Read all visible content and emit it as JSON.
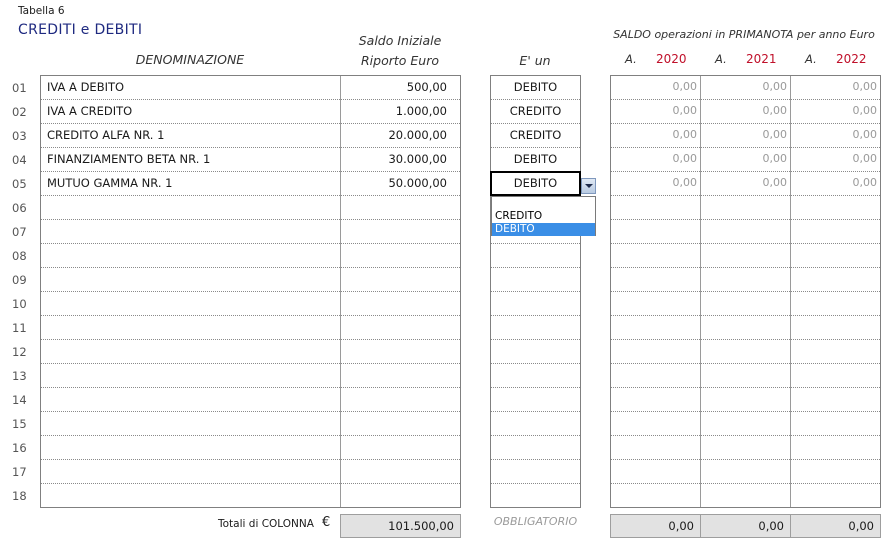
{
  "sheet": {
    "caption": "Tabella 6",
    "title": "CREDITI e DEBITI"
  },
  "headers": {
    "denominazione": "DENOMINAZIONE",
    "saldo_line1": "Saldo Iniziale",
    "saldo_line2": "Riporto Euro",
    "eun": "E' un",
    "primanota": "SALDO operazioni in PRIMANOTA per anno Euro",
    "year_prefix": "A.",
    "years": [
      "2020",
      "2021",
      "2022"
    ]
  },
  "row_numbers": [
    "01",
    "02",
    "03",
    "04",
    "05",
    "06",
    "07",
    "08",
    "09",
    "10",
    "11",
    "12",
    "13",
    "14",
    "15",
    "16",
    "17",
    "18"
  ],
  "rows": [
    {
      "name": "IVA A DEBITO",
      "saldo": "500,00",
      "type": "DEBITO",
      "y2020": "0,00",
      "y2021": "0,00",
      "y2022": "0,00"
    },
    {
      "name": "IVA A CREDITO",
      "saldo": "1.000,00",
      "type": "CREDITO",
      "y2020": "0,00",
      "y2021": "0,00",
      "y2022": "0,00"
    },
    {
      "name": "CREDITO ALFA NR. 1",
      "saldo": "20.000,00",
      "type": "CREDITO",
      "y2020": "0,00",
      "y2021": "0,00",
      "y2022": "0,00"
    },
    {
      "name": "FINANZIAMENTO BETA NR. 1",
      "saldo": "30.000,00",
      "type": "DEBITO",
      "y2020": "0,00",
      "y2021": "0,00",
      "y2022": "0,00"
    },
    {
      "name": "MUTUO GAMMA NR. 1",
      "saldo": "50.000,00",
      "type": "DEBITO",
      "y2020": "0,00",
      "y2021": "0,00",
      "y2022": "0,00"
    }
  ],
  "dropdown": {
    "options": [
      "CREDITO",
      "DEBITO"
    ],
    "selected": "DEBITO",
    "icon": "chevron-down-icon"
  },
  "footer": {
    "label": "Totali di COLONNA",
    "currency": "€",
    "total_saldo": "101.500,00",
    "obbligatorio": "OBBLIGATORIO",
    "totals_years": [
      "0,00",
      "0,00",
      "0,00"
    ]
  },
  "colors": {
    "title": "#1f2a80",
    "year": "#c0102a",
    "dropdown_selected": "#3a8ee6",
    "footer_fill": "#e2e2e2"
  }
}
